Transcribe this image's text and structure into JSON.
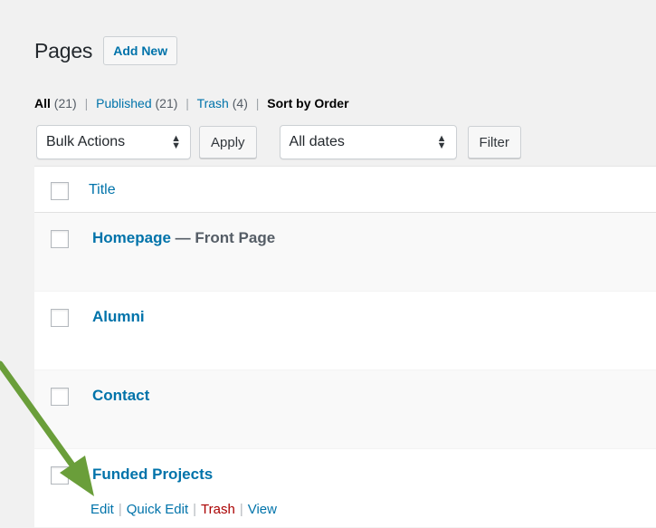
{
  "header": {
    "title": "Pages",
    "add_new_label": "Add New"
  },
  "views": {
    "all_label": "All",
    "all_count": "(21)",
    "published_label": "Published",
    "published_count": "(21)",
    "trash_label": "Trash",
    "trash_count": "(4)",
    "sort_label": "Sort by Order",
    "separator": "|"
  },
  "filters": {
    "bulk_actions_value": "Bulk Actions",
    "apply_label": "Apply",
    "dates_value": "All dates",
    "filter_label": "Filter"
  },
  "table": {
    "title_header": "Title",
    "rows": [
      {
        "title": "Homepage",
        "state": " — Front Page"
      },
      {
        "title": "Alumni"
      },
      {
        "title": "Contact"
      },
      {
        "title": "Funded Projects"
      }
    ],
    "row_actions": {
      "edit": "Edit",
      "quick_edit": "Quick Edit",
      "trash": "Trash",
      "view": "View",
      "separator": "|"
    }
  },
  "colors": {
    "link": "#0073aa",
    "trash": "#aa0000",
    "annotation_arrow": "#6a9e3a"
  }
}
